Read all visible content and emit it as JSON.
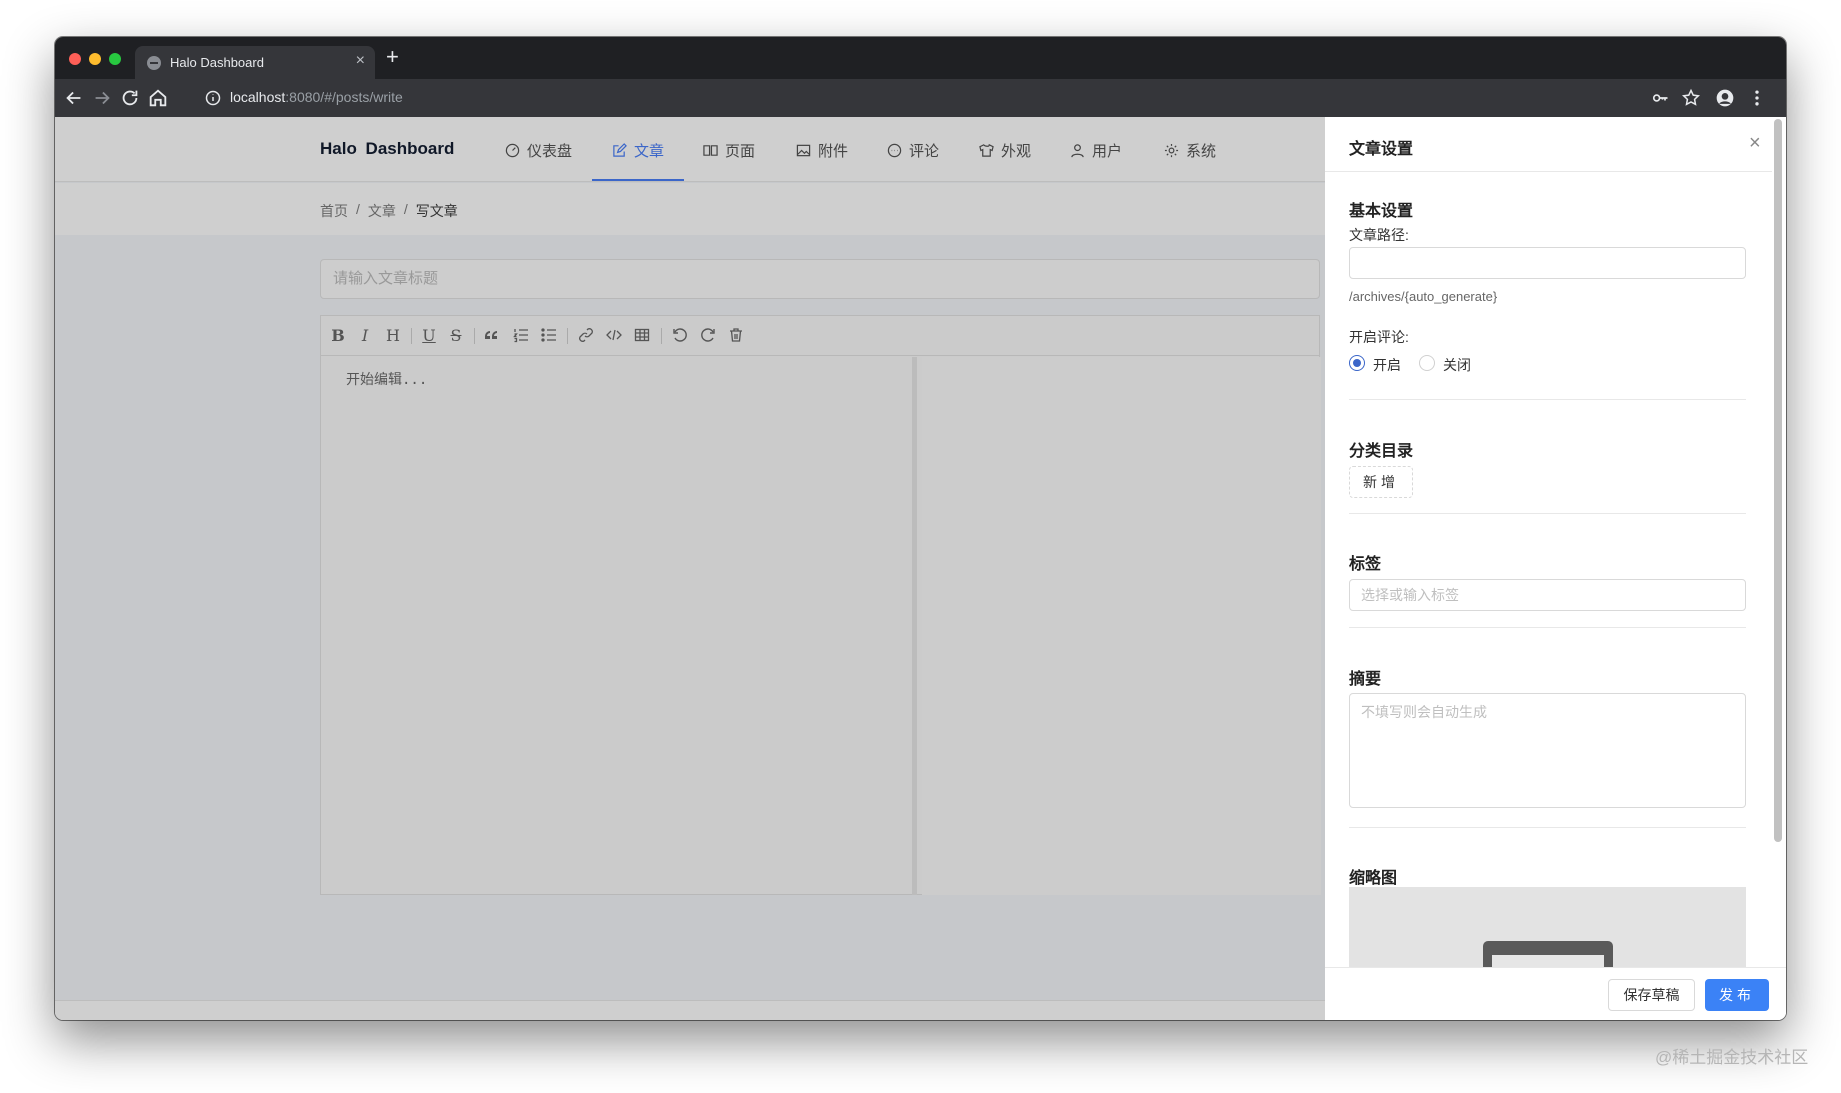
{
  "browser": {
    "tab_title": "Halo Dashboard",
    "tab_close": "×",
    "new_tab": "+",
    "url_host": "localhost",
    "url_rest": ":8080/#/posts/write"
  },
  "app": {
    "brand": "Halo Dashboard",
    "menu": [
      {
        "label": "仪表盘",
        "icon": "dashboard-icon"
      },
      {
        "label": "文章",
        "icon": "edit-icon",
        "active": true
      },
      {
        "label": "页面",
        "icon": "book-icon"
      },
      {
        "label": "附件",
        "icon": "picture-icon"
      },
      {
        "label": "评论",
        "icon": "message-icon"
      },
      {
        "label": "外观",
        "icon": "skin-icon"
      },
      {
        "label": "用户",
        "icon": "user-icon"
      },
      {
        "label": "系统",
        "icon": "setting-icon"
      }
    ],
    "accent_color": "#3b66c9"
  },
  "breadcrumb": {
    "home": "首页",
    "sep": "/",
    "posts": "文章",
    "current": "写文章"
  },
  "editor": {
    "title_placeholder": "请输入文章标题",
    "content_placeholder": "开始编辑...",
    "toolbar": {
      "bold": "B",
      "italic": "I",
      "heading": "H",
      "underline": "U",
      "strike": "S"
    }
  },
  "drawer": {
    "title": "文章设置",
    "close": "×",
    "basic": {
      "title": "基本设置",
      "path_label": "文章路径:",
      "path_value": "",
      "path_help": "/archives/{auto_generate}",
      "comment_label": "开启评论:",
      "comment_on": "开启",
      "comment_off": "关闭"
    },
    "category": {
      "title": "分类目录",
      "add": "新增"
    },
    "tags": {
      "title": "标签",
      "placeholder": "选择或输入标签"
    },
    "summary": {
      "title": "摘要",
      "placeholder": "不填写则会自动生成"
    },
    "thumbnail": {
      "title": "缩略图"
    },
    "save_draft": "保存草稿",
    "publish": "发布"
  },
  "watermark": "@稀土掘金技术社区"
}
